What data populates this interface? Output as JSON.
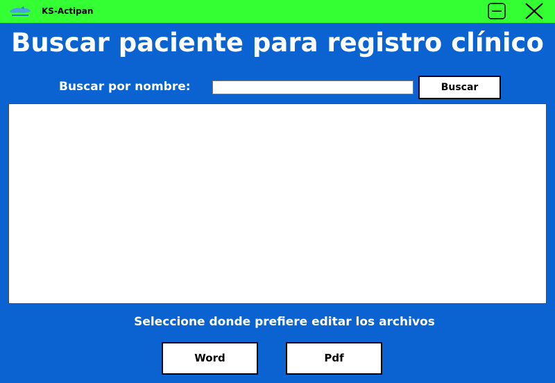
{
  "window": {
    "title": "KS-Actipan",
    "minimize_icon": "minimize-icon",
    "close_icon": "close-icon",
    "titlebar_color": "#33ff33",
    "background_color": "#0a63d1"
  },
  "main": {
    "title": "Buscar paciente para registro clínico",
    "search": {
      "label": "Buscar por nombre:",
      "value": "",
      "placeholder": "",
      "button_label": "Buscar"
    },
    "results": [],
    "editor_prompt": "Seleccione donde prefiere editar los archivos",
    "word_button_label": "Word",
    "pdf_button_label": "Pdf"
  }
}
